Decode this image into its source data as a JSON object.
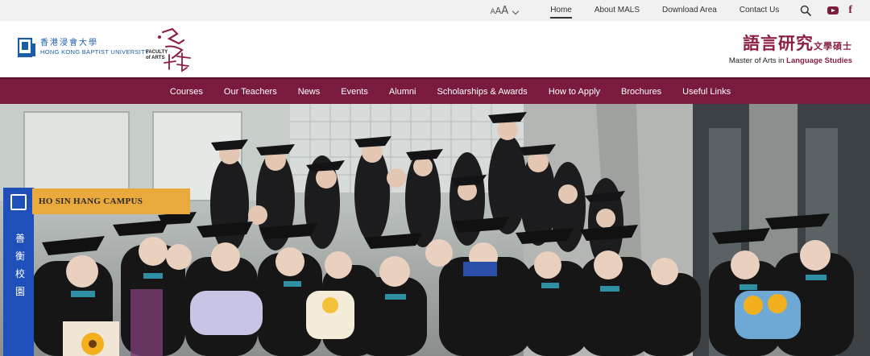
{
  "topbar": {
    "font_size_control": {
      "small": "A",
      "medium": "A",
      "large": "A",
      "icon": "chevron-down-icon"
    },
    "links": [
      {
        "label": "Home",
        "active": true
      },
      {
        "label": "About MALS",
        "active": false
      },
      {
        "label": "Download Area",
        "active": false
      },
      {
        "label": "Contact Us",
        "active": false
      }
    ],
    "icons": [
      "search-icon",
      "youtube-icon",
      "facebook-icon"
    ],
    "facebook_glyph": "f"
  },
  "header": {
    "university_zh": "香港浸會大學",
    "university_en": "HONG KONG BAPTIST UNIVERSITY",
    "faculty_label_1": "FACULTY",
    "faculty_label_2": "of ARTS",
    "program_zh": "語言研究",
    "program_zh_small": "文學碩士",
    "program_en_prefix": "Master of Arts in",
    "program_en_highlight": "Language Studies"
  },
  "nav": {
    "items": [
      "Courses",
      "Our Teachers",
      "News",
      "Events",
      "Alumni",
      "Scholarships & Awards",
      "How to Apply",
      "Brochures",
      "Useful Links"
    ]
  },
  "hero": {
    "campus_sign": "HO SIN HANG CAMPUS",
    "vertical_sign": [
      "善",
      "衡",
      "校",
      "園"
    ]
  },
  "colors": {
    "brand": "#7a1b3e",
    "brand_text": "#8c1f46",
    "hkbu_blue": "#1a5ca6",
    "topbar_bg": "#f1f1f1"
  }
}
